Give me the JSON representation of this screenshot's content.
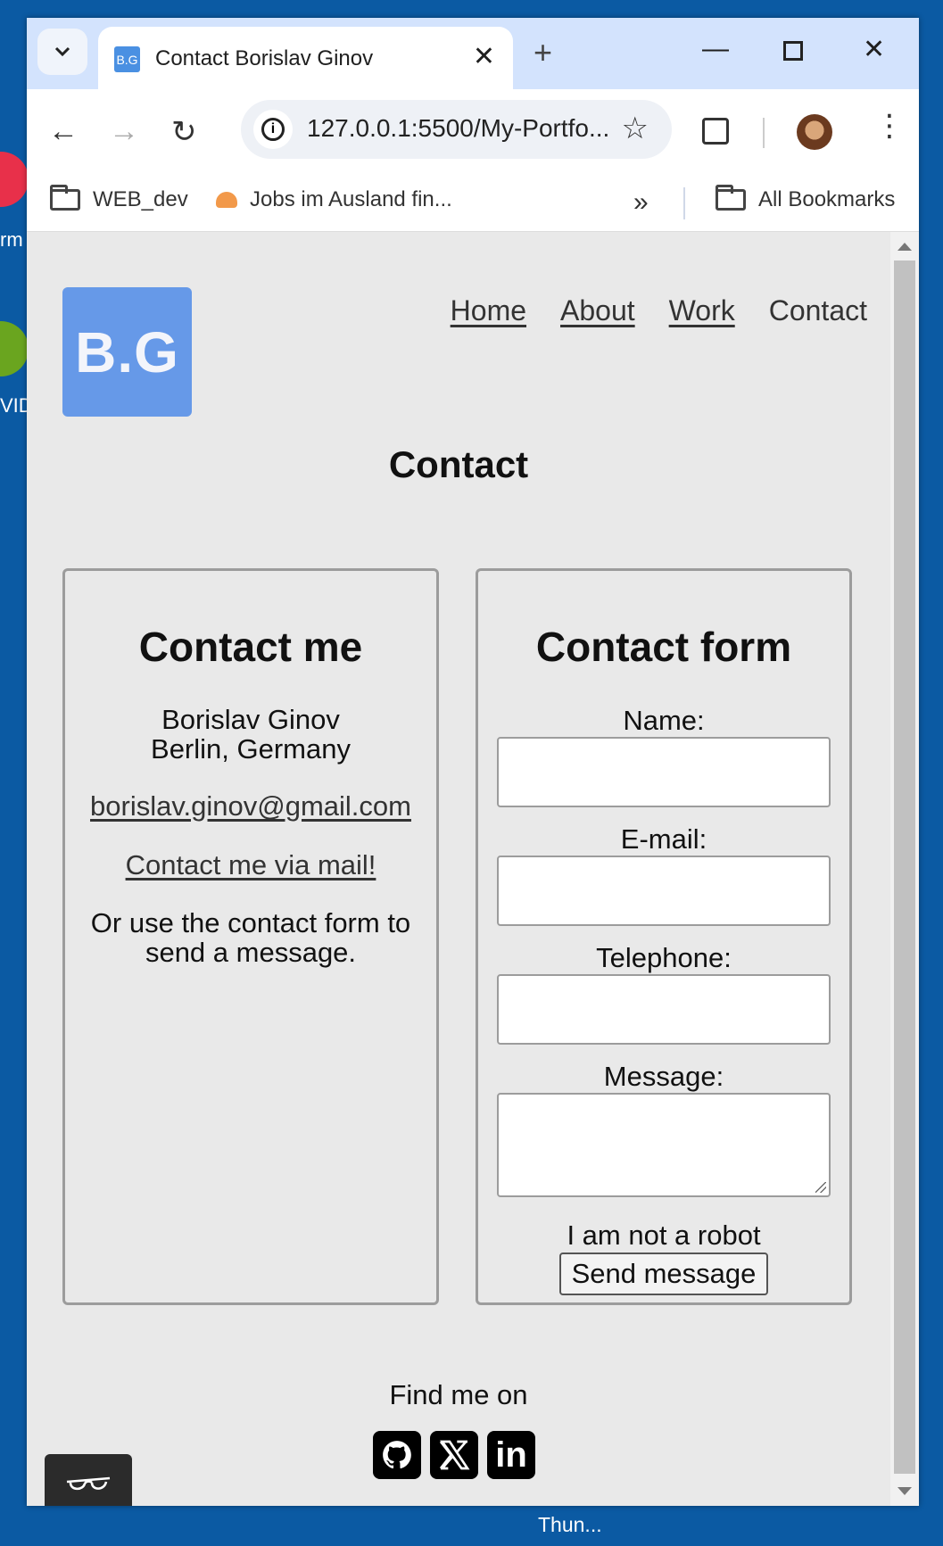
{
  "desktop": {
    "label_1": "rm",
    "label_2": "VID",
    "taskbar_label": "Thun..."
  },
  "browser": {
    "tab": {
      "favicon_text": "B.G",
      "title": "Contact Borislav Ginov"
    },
    "url": "127.0.0.1:5500/My-Portfo...",
    "bookmarks": [
      {
        "label": "WEB_dev",
        "icon": "folder-icon"
      },
      {
        "label": "Jobs im Ausland fin...",
        "icon": "bookmark-site-icon"
      }
    ],
    "all_bookmarks": "All Bookmarks"
  },
  "site": {
    "logo": "B.G",
    "nav": [
      "Home",
      "About",
      "Work",
      "Contact"
    ],
    "page_title": "Contact",
    "contact_me": {
      "heading": "Contact me",
      "name": "Borislav Ginov",
      "location": "Berlin, Germany",
      "email": "borislav.ginov@gmail.com",
      "mail_link": "Contact me via mail!",
      "note": "Or use the contact form to send a message."
    },
    "contact_form": {
      "heading": "Contact form",
      "name_label": "Name:",
      "email_label": "E-mail:",
      "phone_label": "Telephone:",
      "message_label": "Message:",
      "robot_text": "I am not a robot",
      "submit_label": "Send message"
    },
    "footer": {
      "find_me": "Find me on",
      "socials": [
        "github-icon",
        "x-icon",
        "linkedin-icon"
      ]
    }
  },
  "colors": {
    "logo_bg": "#6699e8",
    "tabstrip": "#d3e3fd",
    "desktop": "#0b5aa3"
  }
}
